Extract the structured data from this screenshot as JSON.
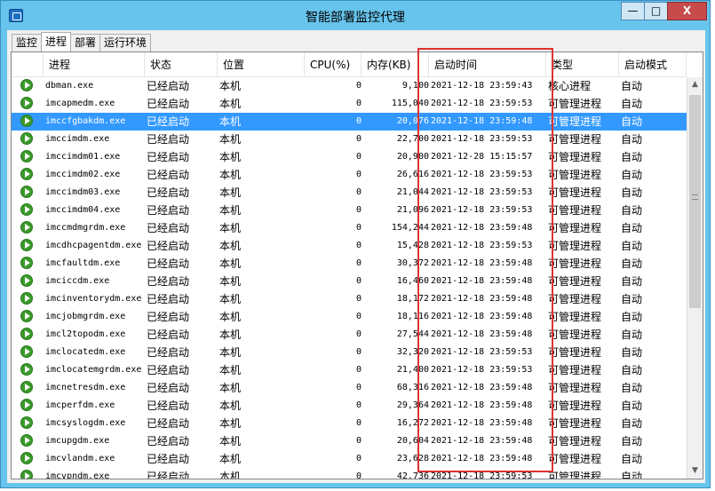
{
  "window": {
    "title": "智能部署监控代理",
    "min_label": "—",
    "max_label": "□",
    "close_label": "X"
  },
  "tabs": [
    {
      "label": "监控"
    },
    {
      "label": "进程",
      "active": true
    },
    {
      "label": "部署"
    },
    {
      "label": "运行环境"
    }
  ],
  "table": {
    "columns": [
      "进程",
      "状态",
      "位置",
      "CPU(%)",
      "内存(KB)",
      "启动时间",
      "类型",
      "启动模式"
    ],
    "rows": [
      {
        "name": "dbman.exe",
        "status": "已经启动",
        "location": "本机",
        "cpu": "0",
        "mem": "9,100",
        "start_time": "2021-12-18 23:59:43",
        "type": "核心进程",
        "mode": "自动"
      },
      {
        "name": "imcapmedm.exe",
        "status": "已经启动",
        "location": "本机",
        "cpu": "0",
        "mem": "115,040",
        "start_time": "2021-12-18 23:59:53",
        "type": "可管理进程",
        "mode": "自动"
      },
      {
        "name": "imccfgbakdm.exe",
        "status": "已经启动",
        "location": "本机",
        "cpu": "0",
        "mem": "20,076",
        "start_time": "2021-12-18 23:59:48",
        "type": "可管理进程",
        "mode": "自动",
        "selected": true
      },
      {
        "name": "imccimdm.exe",
        "status": "已经启动",
        "location": "本机",
        "cpu": "0",
        "mem": "22,700",
        "start_time": "2021-12-18 23:59:53",
        "type": "可管理进程",
        "mode": "自动"
      },
      {
        "name": "imccimdm01.exe",
        "status": "已经启动",
        "location": "本机",
        "cpu": "0",
        "mem": "20,900",
        "start_time": "2021-12-28 15:15:57",
        "type": "可管理进程",
        "mode": "自动"
      },
      {
        "name": "imccimdm02.exe",
        "status": "已经启动",
        "location": "本机",
        "cpu": "0",
        "mem": "26,616",
        "start_time": "2021-12-18 23:59:53",
        "type": "可管理进程",
        "mode": "自动"
      },
      {
        "name": "imccimdm03.exe",
        "status": "已经启动",
        "location": "本机",
        "cpu": "0",
        "mem": "21,044",
        "start_time": "2021-12-18 23:59:53",
        "type": "可管理进程",
        "mode": "自动"
      },
      {
        "name": "imccimdm04.exe",
        "status": "已经启动",
        "location": "本机",
        "cpu": "0",
        "mem": "21,096",
        "start_time": "2021-12-18 23:59:53",
        "type": "可管理进程",
        "mode": "自动"
      },
      {
        "name": "imccmdmgrdm.exe",
        "status": "已经启动",
        "location": "本机",
        "cpu": "0",
        "mem": "154,244",
        "start_time": "2021-12-18 23:59:48",
        "type": "可管理进程",
        "mode": "自动"
      },
      {
        "name": "imcdhcpagentdm.exe",
        "status": "已经启动",
        "location": "本机",
        "cpu": "0",
        "mem": "15,428",
        "start_time": "2021-12-18 23:59:53",
        "type": "可管理进程",
        "mode": "自动"
      },
      {
        "name": "imcfaultdm.exe",
        "status": "已经启动",
        "location": "本机",
        "cpu": "0",
        "mem": "30,372",
        "start_time": "2021-12-18 23:59:48",
        "type": "可管理进程",
        "mode": "自动"
      },
      {
        "name": "imciccdm.exe",
        "status": "已经启动",
        "location": "本机",
        "cpu": "0",
        "mem": "16,460",
        "start_time": "2021-12-18 23:59:48",
        "type": "可管理进程",
        "mode": "自动"
      },
      {
        "name": "imcinventorydm.exe",
        "status": "已经启动",
        "location": "本机",
        "cpu": "0",
        "mem": "18,172",
        "start_time": "2021-12-18 23:59:48",
        "type": "可管理进程",
        "mode": "自动"
      },
      {
        "name": "imcjobmgrdm.exe",
        "status": "已经启动",
        "location": "本机",
        "cpu": "0",
        "mem": "18,116",
        "start_time": "2021-12-18 23:59:48",
        "type": "可管理进程",
        "mode": "自动"
      },
      {
        "name": "imcl2topodm.exe",
        "status": "已经启动",
        "location": "本机",
        "cpu": "0",
        "mem": "27,544",
        "start_time": "2021-12-18 23:59:48",
        "type": "可管理进程",
        "mode": "自动"
      },
      {
        "name": "imclocatedm.exe",
        "status": "已经启动",
        "location": "本机",
        "cpu": "0",
        "mem": "32,320",
        "start_time": "2021-12-18 23:59:53",
        "type": "可管理进程",
        "mode": "自动"
      },
      {
        "name": "imclocatemgrdm.exe",
        "status": "已经启动",
        "location": "本机",
        "cpu": "0",
        "mem": "21,400",
        "start_time": "2021-12-18 23:59:53",
        "type": "可管理进程",
        "mode": "自动"
      },
      {
        "name": "imcnetresdm.exe",
        "status": "已经启动",
        "location": "本机",
        "cpu": "0",
        "mem": "68,316",
        "start_time": "2021-12-18 23:59:48",
        "type": "可管理进程",
        "mode": "自动"
      },
      {
        "name": "imcperfdm.exe",
        "status": "已经启动",
        "location": "本机",
        "cpu": "0",
        "mem": "29,364",
        "start_time": "2021-12-18 23:59:48",
        "type": "可管理进程",
        "mode": "自动"
      },
      {
        "name": "imcsyslogdm.exe",
        "status": "已经启动",
        "location": "本机",
        "cpu": "0",
        "mem": "16,272",
        "start_time": "2021-12-18 23:59:48",
        "type": "可管理进程",
        "mode": "自动"
      },
      {
        "name": "imcupgdm.exe",
        "status": "已经启动",
        "location": "本机",
        "cpu": "0",
        "mem": "20,604",
        "start_time": "2021-12-18 23:59:48",
        "type": "可管理进程",
        "mode": "自动"
      },
      {
        "name": "imcvlandm.exe",
        "status": "已经启动",
        "location": "本机",
        "cpu": "0",
        "mem": "23,628",
        "start_time": "2021-12-18 23:59:48",
        "type": "可管理进程",
        "mode": "自动"
      },
      {
        "name": "imcvpndm.exe",
        "status": "已经启动",
        "location": "本机",
        "cpu": "0",
        "mem": "42,736",
        "start_time": "2021-12-18 23:59:53",
        "type": "可管理进程",
        "mode": "自动"
      }
    ]
  },
  "icons": {
    "app": "app-icon",
    "row": "play-icon",
    "scroll_up": "chevron-up-icon",
    "scroll_down": "chevron-down-icon"
  },
  "colors": {
    "titlebar": "#67c4ec",
    "selection": "#3399ff",
    "highlight_box": "#e0312f",
    "play_icon": "#3a9a2a"
  }
}
